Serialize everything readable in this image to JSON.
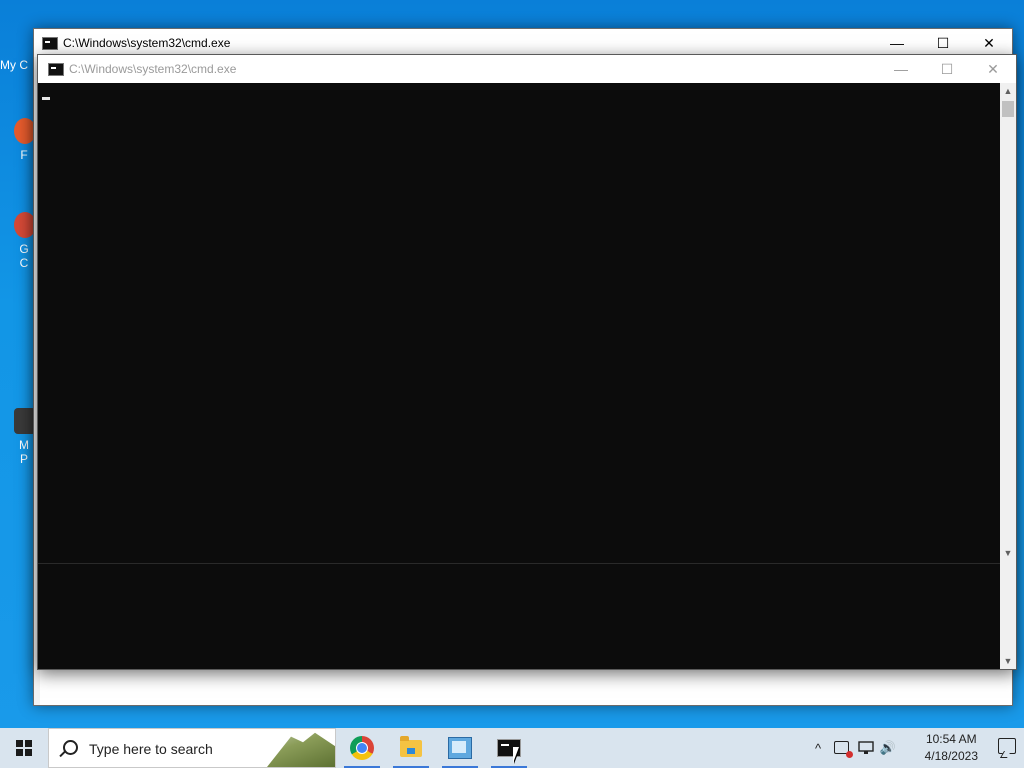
{
  "desktop": {
    "icons": [
      {
        "label": "My C",
        "icon": "computer-icon"
      },
      {
        "label": "F",
        "icon": "firefox-icon"
      },
      {
        "label": "G C",
        "icon": "chrome-icon"
      },
      {
        "label": "M P",
        "icon": "app-icon"
      }
    ]
  },
  "window_back": {
    "title": "C:\\Windows\\system32\\cmd.exe",
    "minimize": "—",
    "maximize": "☐",
    "close": "✕"
  },
  "window_front": {
    "title": "C:\\Windows\\system32\\cmd.exe",
    "minimize": "—",
    "maximize": "☐",
    "close": "✕",
    "scroll_up": "▲",
    "scroll_down": "▼"
  },
  "taskbar": {
    "search_placeholder": "Type here to search",
    "apps": [
      {
        "name": "Google Chrome",
        "icon": "chrome-icon"
      },
      {
        "name": "File Explorer",
        "icon": "folder-icon"
      },
      {
        "name": "Control Panel",
        "icon": "control-panel-icon"
      },
      {
        "name": "Command Prompt",
        "icon": "cmd-icon"
      }
    ],
    "tray": {
      "clock_time": "10:54 AM",
      "clock_date": "4/18/2023",
      "show_hidden": "^",
      "speaker": "🔊"
    }
  }
}
